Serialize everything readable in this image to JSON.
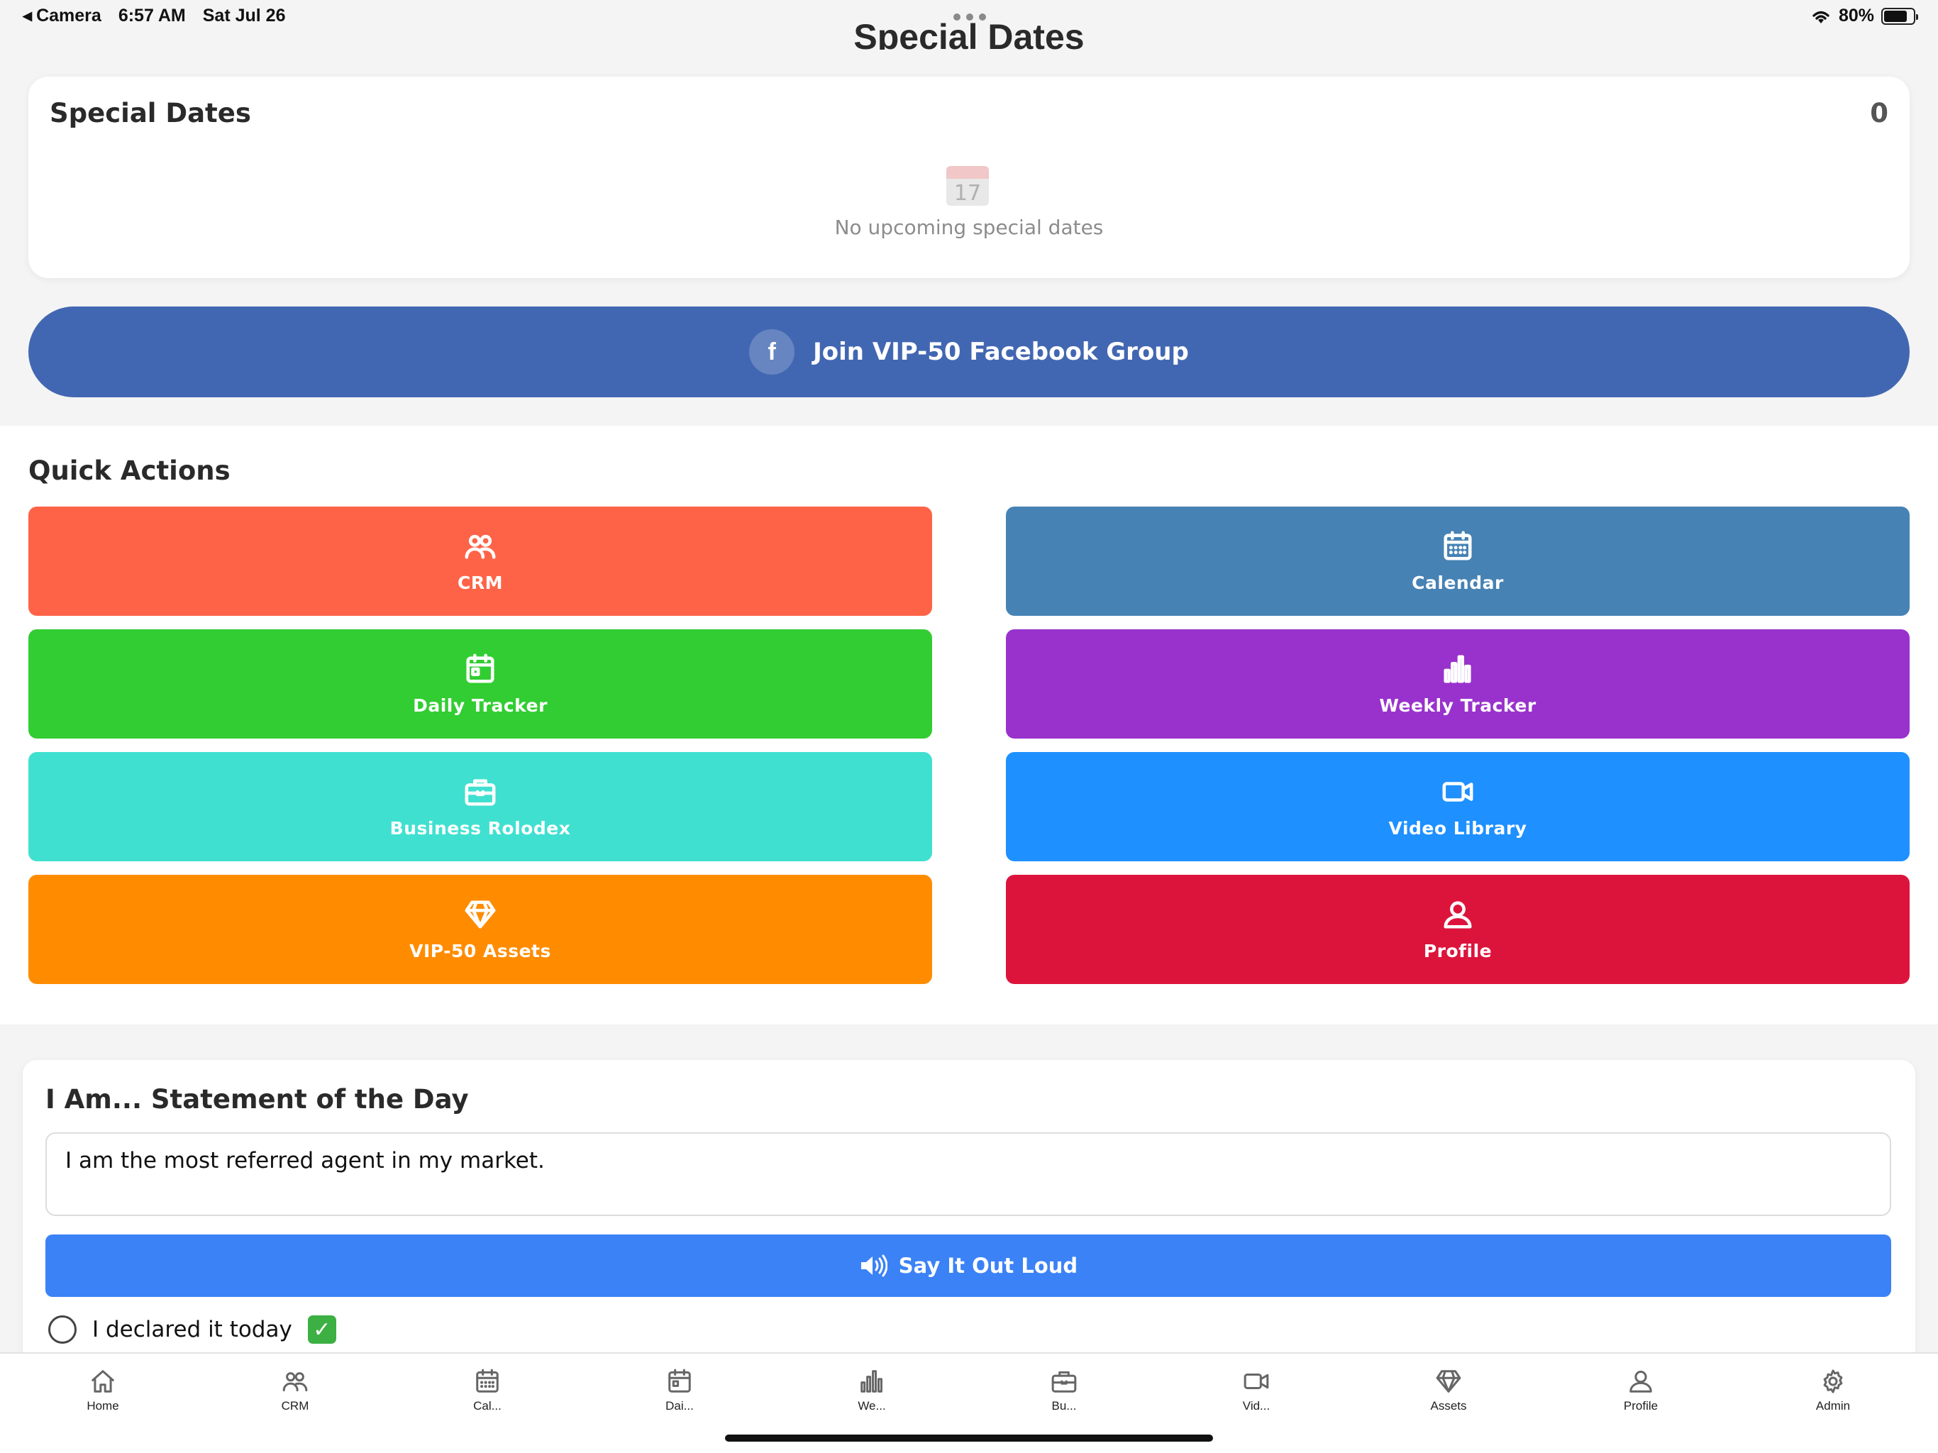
{
  "status_bar": {
    "back_app": "Camera",
    "time": "6:57 AM",
    "date": "Sat Jul 26",
    "battery": "80%",
    "battery_level": 0.8
  },
  "page": {
    "heading": "Special Dates"
  },
  "special_dates": {
    "title": "Special Dates",
    "count": "0",
    "calendar_day": "17",
    "empty_text": "No upcoming special dates"
  },
  "facebook": {
    "icon_letter": "f",
    "label": "Join VIP-50 Facebook Group",
    "color": "#4267b2"
  },
  "quick_actions": {
    "title": "Quick Actions",
    "tiles": [
      {
        "label": "CRM",
        "icon": "users-icon",
        "color": "#ff6347"
      },
      {
        "label": "Calendar",
        "icon": "calendar-icon",
        "color": "#4682b4"
      },
      {
        "label": "Daily Tracker",
        "icon": "calendar-day-icon",
        "color": "#32cd32"
      },
      {
        "label": "Weekly Tracker",
        "icon": "bar-chart-icon",
        "color": "#9932cc"
      },
      {
        "label": "Business Rolodex",
        "icon": "briefcase-icon",
        "color": "#40e0d0"
      },
      {
        "label": "Video Library",
        "icon": "video-icon",
        "color": "#1e90ff"
      },
      {
        "label": "VIP-50 Assets",
        "icon": "diamond-icon",
        "color": "#ff8c00"
      },
      {
        "label": "Profile",
        "icon": "user-icon",
        "color": "#dc143c"
      }
    ]
  },
  "statement": {
    "title": "I Am... Statement of the Day",
    "text": "I am the most referred agent in my market.",
    "say_button": "Say It Out Loud",
    "declare_label": "I declared it today",
    "declared": false
  },
  "tab_bar": {
    "tabs": [
      {
        "label": "Home",
        "icon": "home-icon"
      },
      {
        "label": "CRM",
        "icon": "users-icon"
      },
      {
        "label": "Cal...",
        "icon": "calendar-icon"
      },
      {
        "label": "Dai...",
        "icon": "calendar-day-icon"
      },
      {
        "label": "We...",
        "icon": "bar-chart-icon"
      },
      {
        "label": "Bu...",
        "icon": "briefcase-icon"
      },
      {
        "label": "Vid...",
        "icon": "video-icon"
      },
      {
        "label": "Assets",
        "icon": "diamond-icon"
      },
      {
        "label": "Profile",
        "icon": "user-icon"
      },
      {
        "label": "Admin",
        "icon": "gear-icon"
      }
    ]
  }
}
